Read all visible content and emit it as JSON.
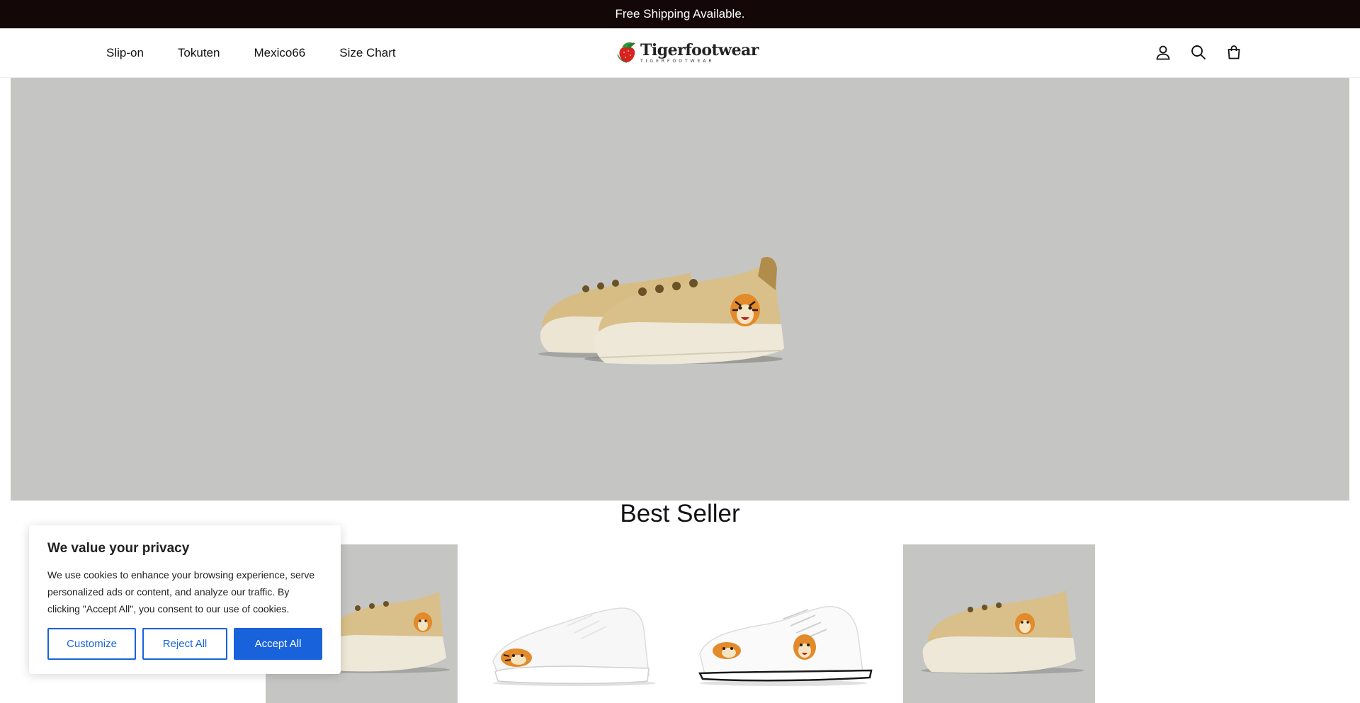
{
  "announcement": {
    "text": "Free Shipping Available."
  },
  "header": {
    "nav": [
      "Slip-on",
      "Tokuten",
      "Mexico66",
      "Size Chart"
    ],
    "logo": {
      "name": "Tigerfootwear",
      "tagline": "TIGERFOOTWEAR"
    },
    "icons": [
      "account-icon",
      "search-icon",
      "cart-icon"
    ]
  },
  "hero": {
    "image": "beige-tiger-slip-on-sneakers"
  },
  "best_seller": {
    "title": "Best Seller",
    "products": [
      {
        "image": "beige-slip-on-tiger-sneaker",
        "bg": "#c5c5c3"
      },
      {
        "image": "white-tiger-sneaker",
        "bg": "#ffffff"
      },
      {
        "image": "white-lace-up-tiger-sneaker",
        "bg": "#ffffff"
      },
      {
        "image": "beige-slip-on-tiger-sneaker",
        "bg": "#c5c5c3"
      }
    ]
  },
  "cookie_banner": {
    "title": "We value your privacy",
    "body": "We use cookies to enhance your browsing experience, serve personalized ads or content, and analyze our traffic. By clicking \"Accept All\", you consent to our use of cookies.",
    "customize": "Customize",
    "reject": "Reject All",
    "accept": "Accept All"
  },
  "colors": {
    "announcement_bg": "#140707",
    "accent": "#1863dc",
    "hero_bg": "#c5c5c3"
  }
}
